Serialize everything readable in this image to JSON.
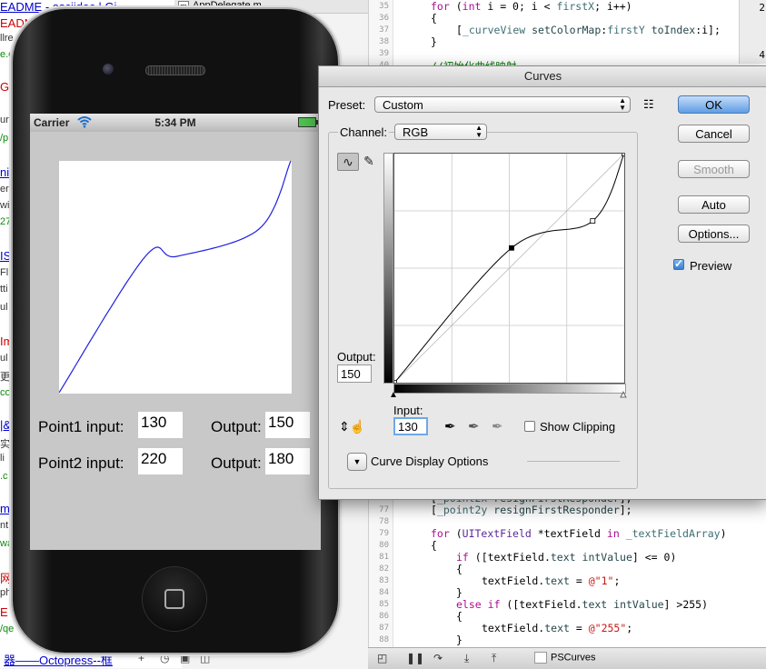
{
  "background": {
    "browser_lines": [
      {
        "text": "EADME - asciidoc | Gi",
        "style": "blue"
      },
      {
        "text": "EADME",
        "style": "red"
      },
      {
        "text": "llre",
        "style": "gray"
      },
      {
        "text": "e.c",
        "style": "green"
      },
      {
        "text": "Gi",
        "style": "red"
      },
      {
        "text": "ur",
        "style": "gray"
      },
      {
        "text": "/p",
        "style": "green"
      },
      {
        "text": "ni",
        "style": "blue"
      },
      {
        "text": "er",
        "style": "gray"
      },
      {
        "text": "wi",
        "style": "gray"
      },
      {
        "text": "27",
        "style": "green"
      },
      {
        "text": "IS",
        "style": "blue"
      },
      {
        "text": "Fl",
        "style": "gray"
      },
      {
        "text": "tti",
        "style": "gray"
      },
      {
        "text": "ul",
        "style": "gray"
      },
      {
        "text": "Im",
        "style": "red"
      },
      {
        "text": "ul",
        "style": "gray"
      },
      {
        "text": "更",
        "style": "gray"
      },
      {
        "text": "co",
        "style": "green"
      },
      {
        "text": "|&",
        "style": "blue"
      },
      {
        "text": "实",
        "style": "gray"
      },
      {
        "text": "li",
        "style": "gray"
      },
      {
        "text": ".c",
        "style": "green"
      },
      {
        "text": "m",
        "style": "blue"
      },
      {
        "text": "nt",
        "style": "gray"
      },
      {
        "text": "wa",
        "style": "green"
      },
      {
        "text": "网",
        "style": "red"
      },
      {
        "text": "ph",
        "style": "gray"
      },
      {
        "text": "E",
        "style": "red"
      },
      {
        "text": "/qe",
        "style": "green"
      }
    ],
    "bottom_left_text": "器——Octopress--框",
    "file_tab": {
      "badge": "m",
      "name": "AppDelegate.m"
    },
    "code_top": [
      {
        "line": "35",
        "code": "for (int i = 0; i < firstX; i++)"
      },
      {
        "line": "36",
        "code": "{"
      },
      {
        "line": "37",
        "code": "[_curveView setColorMap:firstY toIndex:i];"
      },
      {
        "line": "38",
        "code": "}"
      },
      {
        "line": "39",
        "code": ""
      },
      {
        "line": "40",
        "code": "//初始化曲线映射"
      }
    ],
    "code_bottom": [
      {
        "line": "76",
        "code": "[_point2x resignFirstResponder];"
      },
      {
        "line": "77",
        "code": "[_point2y resignFirstResponder];"
      },
      {
        "line": "78",
        "code": ""
      },
      {
        "line": "79",
        "code": "for (UITextField *textField in _textFieldArray)"
      },
      {
        "line": "80",
        "code": "{"
      },
      {
        "line": "81",
        "code": "if ([textField.text intValue] <= 0)"
      },
      {
        "line": "82",
        "code": "{"
      },
      {
        "line": "83",
        "code": "textField.text = @\"1\";"
      },
      {
        "line": "84",
        "code": "}"
      },
      {
        "line": "85",
        "code": "else if ([textField.text intValue] >255)"
      },
      {
        "line": "86",
        "code": "{"
      },
      {
        "line": "87",
        "code": "textField.text = @\"255\";"
      },
      {
        "line": "88",
        "code": "}"
      }
    ],
    "right_strip_digits": [
      "2",
      "4"
    ],
    "debug_scheme": "PSCurves"
  },
  "simulator": {
    "status": {
      "carrier": "Carrier",
      "time": "5:34 PM"
    },
    "curve_color": "#2020e0",
    "inputs": {
      "point1_label": "Point1 input:",
      "point1_input": "130",
      "output1_label": "Output:",
      "output1_value": "150",
      "point2_label": "Point2 input:",
      "point2_input": "220",
      "output2_label": "Output:",
      "output2_value": "180"
    }
  },
  "dialog": {
    "title": "Curves",
    "preset_label": "Preset:",
    "preset_value": "Custom",
    "channel_label": "Channel:",
    "channel_value": "RGB",
    "output_label": "Output:",
    "output_value": "150",
    "input_label": "Input:",
    "input_value": "130",
    "show_clipping_label": "Show Clipping",
    "curve_display_options_label": "Curve Display Options",
    "buttons": {
      "ok": "OK",
      "cancel": "Cancel",
      "smooth": "Smooth",
      "auto": "Auto",
      "options": "Options..."
    },
    "preview_label": "Preview",
    "preview_checked": true,
    "show_clipping_checked": false
  }
}
